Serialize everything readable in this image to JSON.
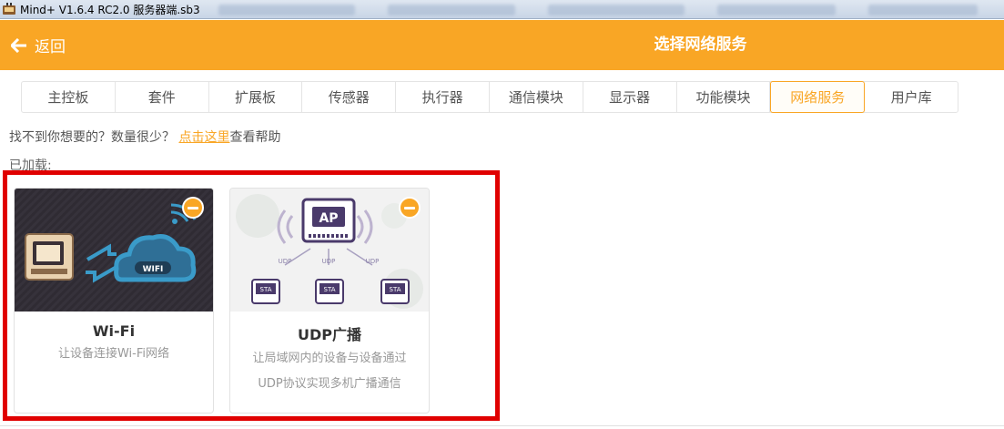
{
  "window": {
    "title": "Mind+ V1.6.4 RC2.0   服务器端.sb3",
    "app_icon": "mindplus-app-icon"
  },
  "header": {
    "back_label": "返回",
    "back_icon": "arrow-left-icon",
    "title": "选择网络服务"
  },
  "tabs": [
    {
      "label": "主控板",
      "active": false
    },
    {
      "label": "套件",
      "active": false
    },
    {
      "label": "扩展板",
      "active": false
    },
    {
      "label": "传感器",
      "active": false
    },
    {
      "label": "执行器",
      "active": false
    },
    {
      "label": "通信模块",
      "active": false
    },
    {
      "label": "显示器",
      "active": false
    },
    {
      "label": "功能模块",
      "active": false
    },
    {
      "label": "网络服务",
      "active": true
    },
    {
      "label": "用户库",
      "active": false
    }
  ],
  "help": {
    "prefix": "找不到你想要的？数量很少？ ",
    "link": "点击这里",
    "suffix": "查看帮助"
  },
  "loaded_label": "已加载:",
  "cards": [
    {
      "name": "Wi-Fi",
      "desc_line1": "让设备连接Wi-Fi网络",
      "desc_line2": "",
      "badge": "WIFI"
    },
    {
      "name": "UDP广播",
      "desc_line1": "让局域网内的设备与设备通过",
      "desc_line2": "UDP协议实现多机广播通信",
      "ap_label": "AP",
      "sta_label": "STA",
      "udp_label": "UDP"
    }
  ],
  "colors": {
    "accent": "#f9a625",
    "highlight": "#e00000",
    "card_dark": "#2f2b33",
    "wifi_blue": "#3a9bc9",
    "purple": "#4a3a6b"
  }
}
